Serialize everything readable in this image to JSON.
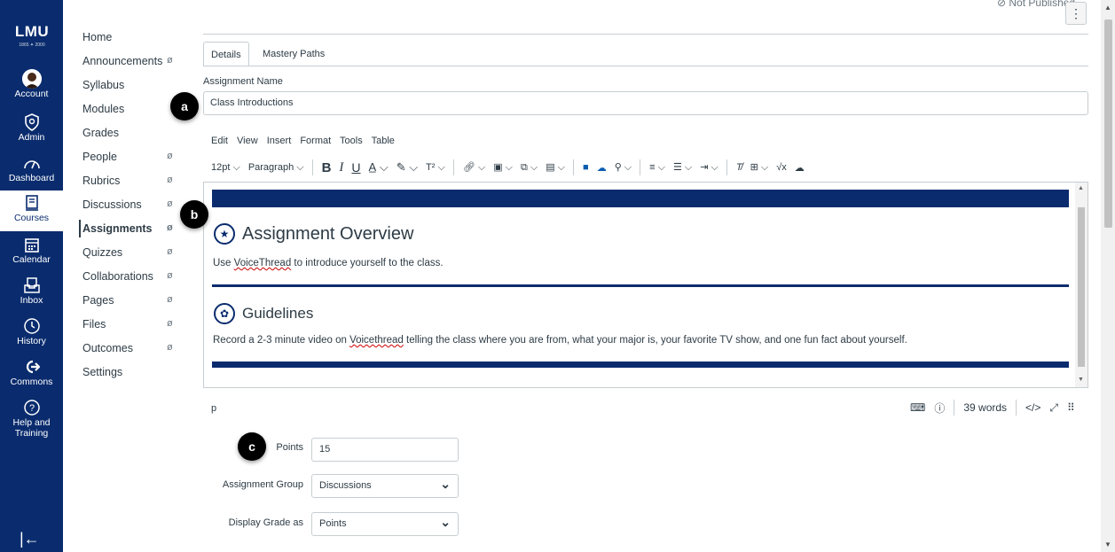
{
  "global_nav": {
    "logo": "LMU",
    "logo_year": "1865 ✦ 2000",
    "items": [
      {
        "label": "Account",
        "icon": "user-avatar-icon"
      },
      {
        "label": "Admin",
        "icon": "shield-icon"
      },
      {
        "label": "Dashboard",
        "icon": "dashboard-icon"
      },
      {
        "label": "Courses",
        "icon": "courses-icon"
      },
      {
        "label": "Calendar",
        "icon": "calendar-icon"
      },
      {
        "label": "Inbox",
        "icon": "inbox-icon"
      },
      {
        "label": "History",
        "icon": "clock-icon"
      },
      {
        "label": "Commons",
        "icon": "commons-icon"
      },
      {
        "label": "Help and Training",
        "icon": "help-icon"
      }
    ],
    "collapse_glyph": "|←"
  },
  "course_nav": {
    "items": [
      {
        "label": "Home"
      },
      {
        "label": "Announcements"
      },
      {
        "label": "Syllabus"
      },
      {
        "label": "Modules"
      },
      {
        "label": "Grades"
      },
      {
        "label": "People"
      },
      {
        "label": "Rubrics"
      },
      {
        "label": "Discussions"
      },
      {
        "label": "Assignments"
      },
      {
        "label": "Quizzes"
      },
      {
        "label": "Collaborations"
      },
      {
        "label": "Pages"
      },
      {
        "label": "Files"
      },
      {
        "label": "Outcomes"
      },
      {
        "label": "Settings"
      }
    ]
  },
  "header": {
    "status": "Not Published",
    "options_glyph": "⋮"
  },
  "tabs": [
    "Details",
    "Mastery Paths"
  ],
  "assignment_name": {
    "label": "Assignment Name",
    "value": "Class Introductions"
  },
  "badges": {
    "a": "a",
    "b": "b",
    "c": "c"
  },
  "editor": {
    "menu": [
      "Edit",
      "View",
      "Insert",
      "Format",
      "Tools",
      "Table"
    ],
    "font_size": "12pt ⌵",
    "block_format": "Paragraph ⌵",
    "heading1": "Assignment Overview",
    "para1_pre": "Use ",
    "para1_link": "VoiceThread",
    "para1_post": " to introduce yourself to the class.",
    "heading2": "Guidelines",
    "para2_pre": "Record a 2-3 minute video on ",
    "para2_link": "Voicethread",
    "para2_post": " telling the class where you are from, what your major is, your favorite TV show, and one fun fact about yourself.",
    "path": "p",
    "word_count": "39 words",
    "html_toggle": "</>"
  },
  "form": {
    "points_label": "Points",
    "points_value": "15",
    "group_label": "Assignment Group",
    "group_value": "Discussions",
    "display_label": "Display Grade as",
    "display_value": "Points"
  },
  "colors": {
    "nav": "#0a2c6e",
    "accent": "#0a2c6e"
  }
}
